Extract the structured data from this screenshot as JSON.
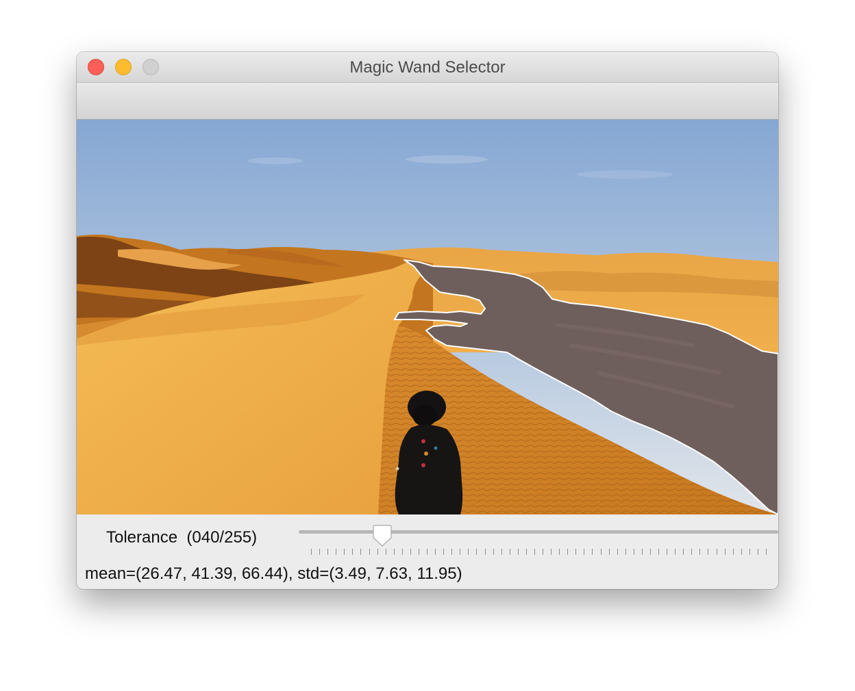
{
  "window": {
    "title": "Magic Wand Selector"
  },
  "image": {
    "description_icon": "image-canvas",
    "selection_color": "#6f5f5c",
    "outline_color": "#ffffff",
    "sky_top": "#86a7d3",
    "sky_bottom": "#dfe4ea",
    "sand_light": "#f4b64a",
    "sand_dark": "#a4601d"
  },
  "controls": {
    "tolerance_label": "Tolerance  (040/255)",
    "tolerance_value": 40,
    "tolerance_max": 255,
    "stats_text": "mean=(26.47, 41.39, 66.44), std=(3.49, 7.63, 11.95)"
  },
  "colors": {
    "close": "#fc5f57",
    "minimize": "#fdbc2e",
    "zoom": "#d0d0d0"
  }
}
